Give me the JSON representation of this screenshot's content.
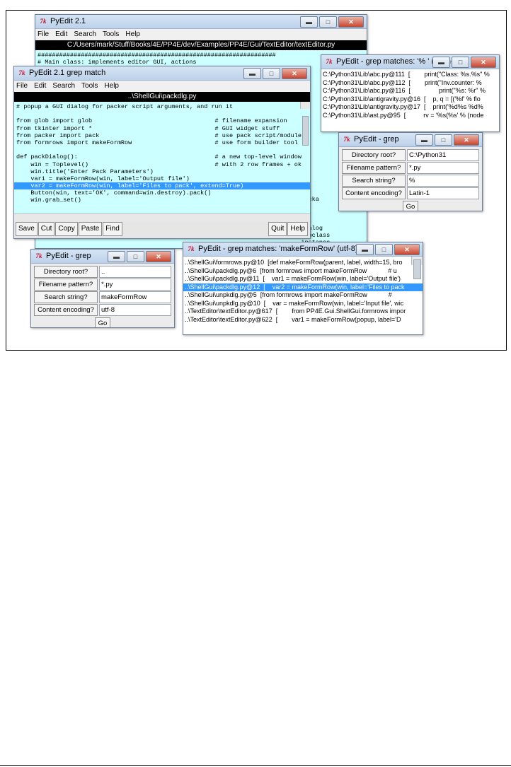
{
  "main_editor": {
    "title": "PyEdit 2.1",
    "menus": [
      "File",
      "Edit",
      "Search",
      "Tools",
      "Help"
    ],
    "path": "C:/Users/mark/Stuff/Books/4E/PP4E/dev/Examples/PP4E/Gui/TextEditor/textEditor.py",
    "lines": [
      "##################################################################",
      "# Main class: implements editor GUI, actions",
      "",
      "",
      "",
      "",
      "",
      "",
      "",
      "",
      "",
      "",
      "",
      "",
      "",
      "",
      "",
      "",
      "",
      "",
      "                                                                         packa",
      "",
      "",
      "",
      "                                                                         dialog",
      "                                                                         subclass",
      "                                                                         instance",
      "                                                         ...ext",
      "               {'Eq':'yellow',       'b'"
    ]
  },
  "grep_editor": {
    "title": "PyEdit 2.1 grep match",
    "menus": [
      "File",
      "Edit",
      "Search",
      "Tools",
      "Help"
    ],
    "path": "..\\ShellGui\\packdlg.py",
    "lines": [
      "# popup a GUI dialog for packer script arguments, and run it",
      "",
      "from glob import glob                                  # filename expansion",
      "from tkinter import *                                  # GUI widget stuff",
      "from packer import pack                                # use pack script/module",
      "from formrows import makeFormRow                       # use form builder tool",
      "",
      "def packDialog():                                      # a new top-level window",
      "    win = Toplevel()                                   # with 2 row frames + ok",
      "    win.title('Enter Pack Parameters')",
      "    var1 = makeFormRow(win, label='Output file')",
      "    var2 = makeFormRow(win, label='Files to pack', extend=True)",
      "    Button(win, text='OK', command=win.destroy).pack()",
      "    win.grab_set()"
    ],
    "selected_line": 11,
    "buttons_left": [
      "Save",
      "Cut",
      "Copy",
      "Paste",
      "Find"
    ],
    "buttons_right": [
      "Quit",
      "Help"
    ]
  },
  "matches_latin": {
    "title": "PyEdit - grep matches: '% ' (Latin-1)",
    "rows": [
      "C:\\Python31\\Lib\\abc.py@111  [        print(\"Class: %s.%s\" %",
      "C:\\Python31\\Lib\\abc.py@112  [        print(\"Inv.counter: %",
      "C:\\Python31\\Lib\\abc.py@116  [                print(\"%s: %r\" %",
      "C:\\Python31\\Lib\\antigravity.py@16  [    p, q = [('%f' % flo",
      "C:\\Python31\\Lib\\antigravity.py@17  [    print('%d%s %d%",
      "C:\\Python31\\Lib\\ast.py@95  [          rv = '%s(%s' % (node"
    ]
  },
  "grep_latin": {
    "title": "PyEdit - grep",
    "fields": [
      {
        "label": "Directory root?",
        "value": "C:\\Python31"
      },
      {
        "label": "Filename pattern?",
        "value": "*.py"
      },
      {
        "label": "Search string?",
        "value": "%"
      },
      {
        "label": "Content encoding?",
        "value": "Latin-1"
      }
    ],
    "go": "Go"
  },
  "grep_utf8": {
    "title": "PyEdit - grep",
    "fields": [
      {
        "label": "Directory root?",
        "value": ".."
      },
      {
        "label": "Filename pattern?",
        "value": "*.py"
      },
      {
        "label": "Search string?",
        "value": "makeFormRow"
      },
      {
        "label": "Content encoding?",
        "value": "utf-8"
      }
    ],
    "go": "Go"
  },
  "matches_utf8": {
    "title": "PyEdit - grep matches: 'makeFormRow' (utf-8)",
    "rows": [
      "..\\ShellGui\\formrows.py@10  [def makeFormRow(parent, label, width=15, bro",
      "..\\ShellGui\\packdlg.py@6  [from formrows import makeFormRow            # u",
      "..\\ShellGui\\packdlg.py@11  [    var1 = makeFormRow(win, label='Output file')",
      "..\\ShellGui\\packdlg.py@12  [    var2 = makeFormRow(win, label='Files to pack",
      "..\\ShellGui\\unpkdlg.py@5  [from formrows import makeFormRow            #",
      "..\\ShellGui\\unpkdlg.py@10  [    var = makeFormRow(win, label='Input file', wic",
      "..\\TextEditor\\textEditor.py@617  [        from PP4E.Gui.ShellGui.formrows impor",
      "..\\TextEditor\\textEditor.py@622  [        var1 = makeFormRow(popup, label='D"
    ],
    "selected_row": 3
  }
}
